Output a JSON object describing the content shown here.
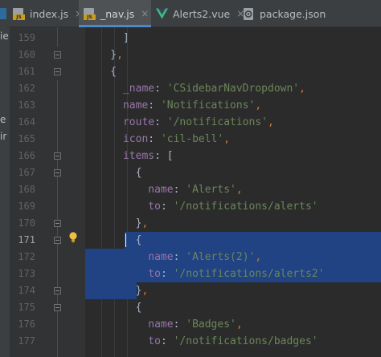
{
  "tabs": [
    {
      "label": "index.js",
      "icon": "js-file-icon",
      "active": false
    },
    {
      "label": "_nav.js",
      "icon": "js-file-icon",
      "active": true
    },
    {
      "label": "Alerts2.vue",
      "icon": "vue-file-icon",
      "active": false
    },
    {
      "label": "package.json",
      "icon": "json-file-icon",
      "active": false
    }
  ],
  "tab_close_glyph": "×",
  "file_badge_text": "JS",
  "side_panel_fragments": [
    "ie",
    "e",
    "ir"
  ],
  "gutter": {
    "line_numbers": [
      "159",
      "160",
      "161",
      "162",
      "163",
      "164",
      "165",
      "166",
      "167",
      "168",
      "169",
      "170",
      "171",
      "172",
      "173",
      "174",
      "175",
      "176",
      "177"
    ],
    "current_line": "171"
  },
  "code_lines": [
    "      ]",
    "    },",
    "    {",
    "      _name: 'CSidebarNavDropdown',",
    "      name: 'Notifications',",
    "      route: '/notifications',",
    "      icon: 'cil-bell',",
    "      items: [",
    "        {",
    "          name: 'Alerts',",
    "          to: '/notifications/alerts'",
    "        },",
    "        {",
    "          name: 'Alerts(2)',",
    "          to: '/notifications/alerts2'",
    "        },",
    "        {",
    "          name: 'Badges',",
    "          to: '/notifications/badges'"
  ],
  "colors": {
    "editor_bg": "#2b2b2b",
    "gutter_bg": "#313335",
    "property": "#9876aa",
    "string": "#6a8759",
    "punctuation": "#cc7832",
    "selection": "#214283",
    "active_tab_underline": "#4a88c7"
  }
}
